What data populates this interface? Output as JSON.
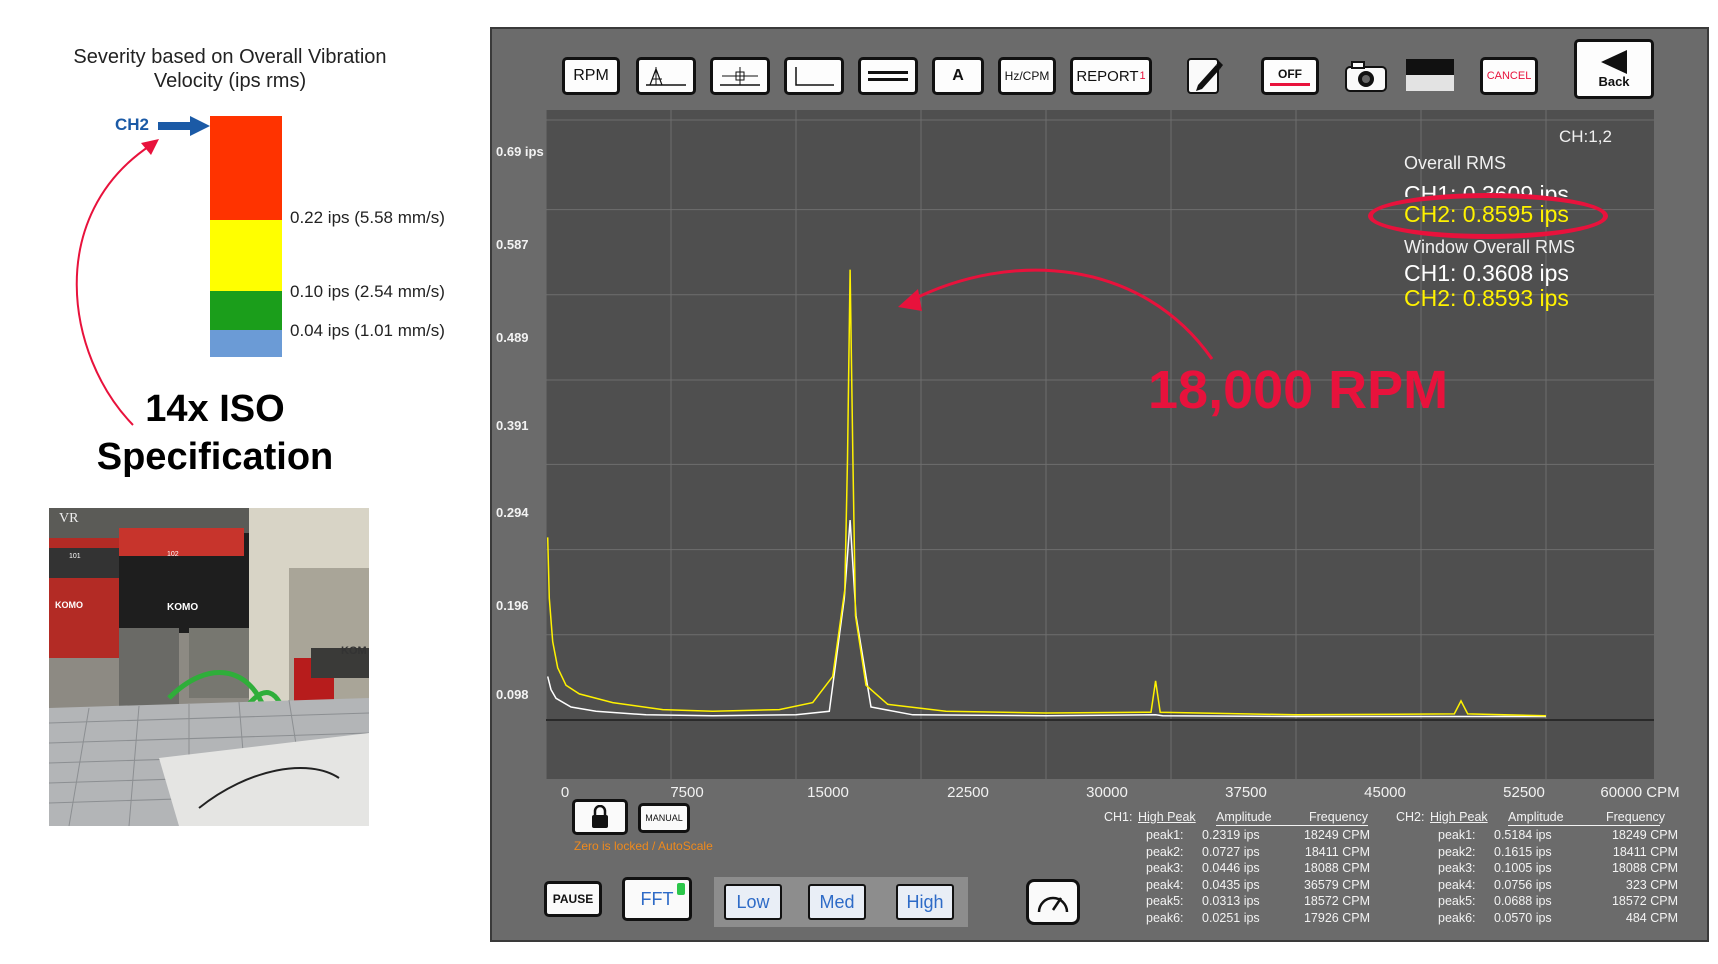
{
  "severity": {
    "title_line1": "Severity based on Overall Vibration",
    "title_line2": "Velocity (ips rms)",
    "channel_marker": "CH2",
    "bands": [
      {
        "label": "0.22 ips (5.58 mm/s)",
        "color": "#ff3300"
      },
      {
        "label": "0.10 ips (2.54 mm/s)",
        "color": "#ffff00"
      },
      {
        "label": "0.04 ips (1.01 mm/s)",
        "color": "#1b9e1b"
      },
      {
        "label": "",
        "color": "#6b9bd6"
      }
    ],
    "callout_line1": "14x ISO",
    "callout_line2": "Specification"
  },
  "photo": {
    "labels": [
      "VR",
      "101",
      "102",
      "KOMO",
      "KOMO",
      "KOM"
    ]
  },
  "toolbar": {
    "rpm": "RPM",
    "a": "A",
    "hz_cpm": "Hz/CPM",
    "report": "REPORT",
    "report_badge": "1",
    "off": "OFF",
    "cancel": "CANCEL",
    "back": "Back"
  },
  "screen": {
    "channel_label": "CH:1,2",
    "overall_title": "Overall RMS",
    "overall_ch1": "CH1:  0.3609 ips",
    "overall_ch2": "CH2:  0.8595 ips",
    "window_title": "Window Overall RMS",
    "window_ch1": "CH1:  0.3608 ips",
    "window_ch2": "CH2:  0.8593 ips",
    "annotation": "18,000 RPM",
    "lock_status": "Zero is locked / AutoScale",
    "manual": "MANUAL",
    "pause": "PAUSE",
    "fft": "FFT",
    "low": "Low",
    "med": "Med",
    "high": "High"
  },
  "chart_data": {
    "type": "line",
    "y_ticks": [
      "0.69 ips",
      "0.587",
      "0.489",
      "0.391",
      "0.294",
      "0.196",
      "0.098"
    ],
    "x_ticks": [
      "0",
      "7500",
      "15000",
      "22500",
      "30000",
      "37500",
      "45000",
      "52500",
      "60000 CPM"
    ],
    "xlim": [
      0,
      60000
    ],
    "ylim": [
      0,
      0.69
    ],
    "series": [
      {
        "name": "CH1",
        "color": "#ffffff",
        "points": [
          [
            100,
            0.05
          ],
          [
            300,
            0.035
          ],
          [
            600,
            0.025
          ],
          [
            1500,
            0.015
          ],
          [
            3000,
            0.01
          ],
          [
            6000,
            0.006
          ],
          [
            10000,
            0.005
          ],
          [
            15000,
            0.006
          ],
          [
            17000,
            0.01
          ],
          [
            17900,
            0.14
          ],
          [
            18249,
            0.23
          ],
          [
            18600,
            0.12
          ],
          [
            19500,
            0.015
          ],
          [
            22000,
            0.006
          ],
          [
            30000,
            0.005
          ],
          [
            36579,
            0.006
          ],
          [
            37000,
            0.005
          ],
          [
            45000,
            0.004
          ],
          [
            54000,
            0.004
          ],
          [
            60000,
            0.004
          ]
        ]
      },
      {
        "name": "CH2",
        "color": "#fff200",
        "points": [
          [
            100,
            0.21
          ],
          [
            200,
            0.14
          ],
          [
            400,
            0.09
          ],
          [
            700,
            0.06
          ],
          [
            1200,
            0.04
          ],
          [
            2000,
            0.03
          ],
          [
            4000,
            0.02
          ],
          [
            7000,
            0.012
          ],
          [
            10000,
            0.01
          ],
          [
            14000,
            0.012
          ],
          [
            16000,
            0.02
          ],
          [
            17200,
            0.05
          ],
          [
            17926,
            0.15
          ],
          [
            18088,
            0.3
          ],
          [
            18249,
            0.518
          ],
          [
            18411,
            0.3
          ],
          [
            18572,
            0.12
          ],
          [
            19200,
            0.04
          ],
          [
            20500,
            0.018
          ],
          [
            24000,
            0.01
          ],
          [
            30000,
            0.008
          ],
          [
            36300,
            0.009
          ],
          [
            36579,
            0.045
          ],
          [
            36850,
            0.009
          ],
          [
            45000,
            0.006
          ],
          [
            54500,
            0.007
          ],
          [
            54900,
            0.022
          ],
          [
            55300,
            0.007
          ],
          [
            60000,
            0.005
          ]
        ]
      }
    ]
  },
  "peaks": {
    "ch1": {
      "title": "CH1:",
      "headers": [
        "High Peak",
        "Amplitude",
        "Frequency"
      ],
      "rows": [
        [
          "peak1:",
          "0.2319 ips",
          "18249 CPM"
        ],
        [
          "peak2:",
          "0.0727 ips",
          "18411 CPM"
        ],
        [
          "peak3:",
          "0.0446 ips",
          "18088 CPM"
        ],
        [
          "peak4:",
          "0.0435 ips",
          "36579 CPM"
        ],
        [
          "peak5:",
          "0.0313 ips",
          "18572 CPM"
        ],
        [
          "peak6:",
          "0.0251 ips",
          "17926 CPM"
        ]
      ]
    },
    "ch2": {
      "title": "CH2:",
      "headers": [
        "High Peak",
        "Amplitude",
        "Frequency"
      ],
      "rows": [
        [
          "peak1:",
          "0.5184 ips",
          "18249 CPM"
        ],
        [
          "peak2:",
          "0.1615 ips",
          "18411 CPM"
        ],
        [
          "peak3:",
          "0.1005 ips",
          "18088 CPM"
        ],
        [
          "peak4:",
          "0.0756 ips",
          "323 CPM"
        ],
        [
          "peak5:",
          "0.0688 ips",
          "18572 CPM"
        ],
        [
          "peak6:",
          "0.0570 ips",
          "484 CPM"
        ]
      ]
    }
  }
}
